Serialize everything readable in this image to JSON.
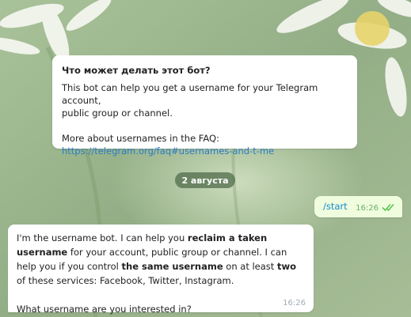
{
  "info_card": {
    "title": "Что может делать этот бот?",
    "text": "This bot can help you get a username for your Telegram account,\npublic group or channel.",
    "faq_label": "More about usernames in the FAQ:",
    "faq_link": "https://telegram.org/faq#usernames-and-t-me"
  },
  "date_separator": "2 августа",
  "outgoing": {
    "text": "/start",
    "time": "16:26",
    "status_icon": "double-check-icon"
  },
  "incoming": {
    "p1": "I'm the username bot. I can help you ",
    "b1": "reclaim a taken username",
    "p2": " for your account, public group or channel. I can help you if you control ",
    "b2": "the same username",
    "p3": " on at least ",
    "b3": "two",
    "p4": " of these services: Facebook, Twitter, Instagram.",
    "question": "What username are you interested in?",
    "time": "16:26"
  },
  "colors": {
    "link": "#2a7cc7",
    "outgoing_bubble": "#effdde",
    "check": "#5dc452"
  }
}
